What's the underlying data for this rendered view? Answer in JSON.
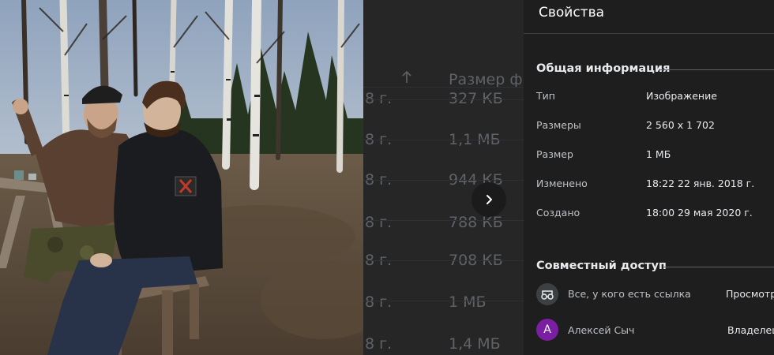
{
  "panel": {
    "title": "Свойства",
    "general": {
      "heading": "Общая информация",
      "rows": [
        {
          "label": "Тип",
          "value": "Изображение"
        },
        {
          "label": "Размеры",
          "value": "2 560 x 1 702"
        },
        {
          "label": "Размер",
          "value": "1 МБ"
        },
        {
          "label": "Изменено",
          "value": "18:22 22 янв. 2018 г."
        },
        {
          "label": "Создано",
          "value": "18:00 29 мая 2020 г."
        }
      ]
    },
    "sharing": {
      "heading": "Совместный доступ",
      "entries": [
        {
          "name": "Все, у кого есть ссылка",
          "role": "Просмотр",
          "icon": "link-icon"
        },
        {
          "name": "Алексей Сыч",
          "role": "Владелец",
          "avatar_letter": "A",
          "avatar_color": "#7b1fa2"
        }
      ]
    }
  },
  "file_list": {
    "size_header": "Размер ф",
    "rows": [
      {
        "date": "8 г.",
        "size": "327 КБ"
      },
      {
        "date": "8 г.",
        "size": "1,1 МБ"
      },
      {
        "date": "8 г.",
        "size": "944 КБ"
      },
      {
        "date": "8 г.",
        "size": "788 КБ"
      },
      {
        "date": "8 г.",
        "size": "708 КБ"
      },
      {
        "date": "8 г.",
        "size": "1 МБ"
      },
      {
        "date": "8 г.",
        "size": "1,4 МБ"
      }
    ]
  },
  "viewer": {
    "next_icon": "chevron-right-icon",
    "image_description": "photo preview"
  }
}
